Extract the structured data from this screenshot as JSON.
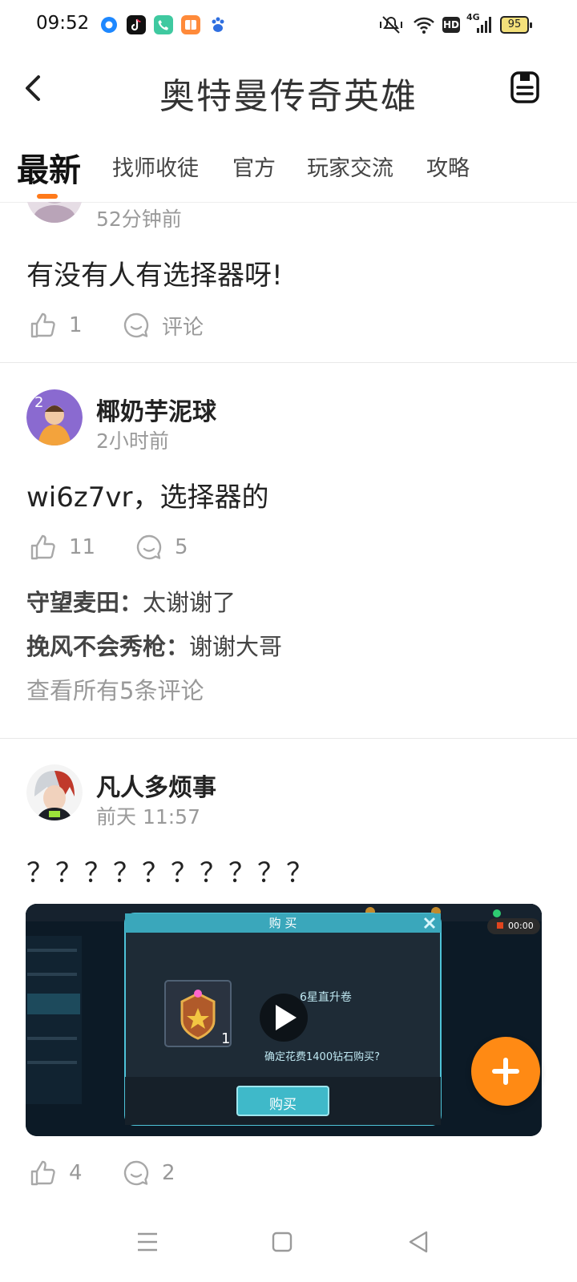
{
  "status_bar": {
    "time": "09:52",
    "network": "4G",
    "battery": "95",
    "hd": "HD"
  },
  "header": {
    "title": "奥特曼传奇英雄"
  },
  "tabs": [
    {
      "label": "最新",
      "active": true
    },
    {
      "label": "找师收徒",
      "active": false
    },
    {
      "label": "官方",
      "active": false
    },
    {
      "label": "玩家交流",
      "active": false
    },
    {
      "label": "攻略",
      "active": false
    }
  ],
  "posts": [
    {
      "time": "52分钟前",
      "text": "有没有人有选择器呀!",
      "likes": "1",
      "comment_label": "评论"
    },
    {
      "user": "椰奶芋泥球",
      "time": "2小时前",
      "text": "wi6z7vr，选择器的",
      "likes": "11",
      "comments": "5",
      "comment_previews": [
        {
          "user": "守望麦田：",
          "text": "太谢谢了"
        },
        {
          "user": "挽风不会秀枪：",
          "text": "谢谢大哥"
        }
      ],
      "view_all": "查看所有5条评论"
    },
    {
      "user": "凡人多烦事",
      "time": "前天 11:57",
      "text": "？？？？？？？？？？",
      "likes": "4",
      "comments": "2",
      "video": {
        "dialog_title": "购 买",
        "item_name": "6星直升卷",
        "confirm_text": "确定花费1400钻石购买?",
        "buy_button": "购买",
        "item_count": "1",
        "record_time": "00:00"
      }
    }
  ],
  "colors": {
    "accent": "#ff7a1a",
    "fab": "#ff8a14",
    "muted_text": "#999999"
  }
}
